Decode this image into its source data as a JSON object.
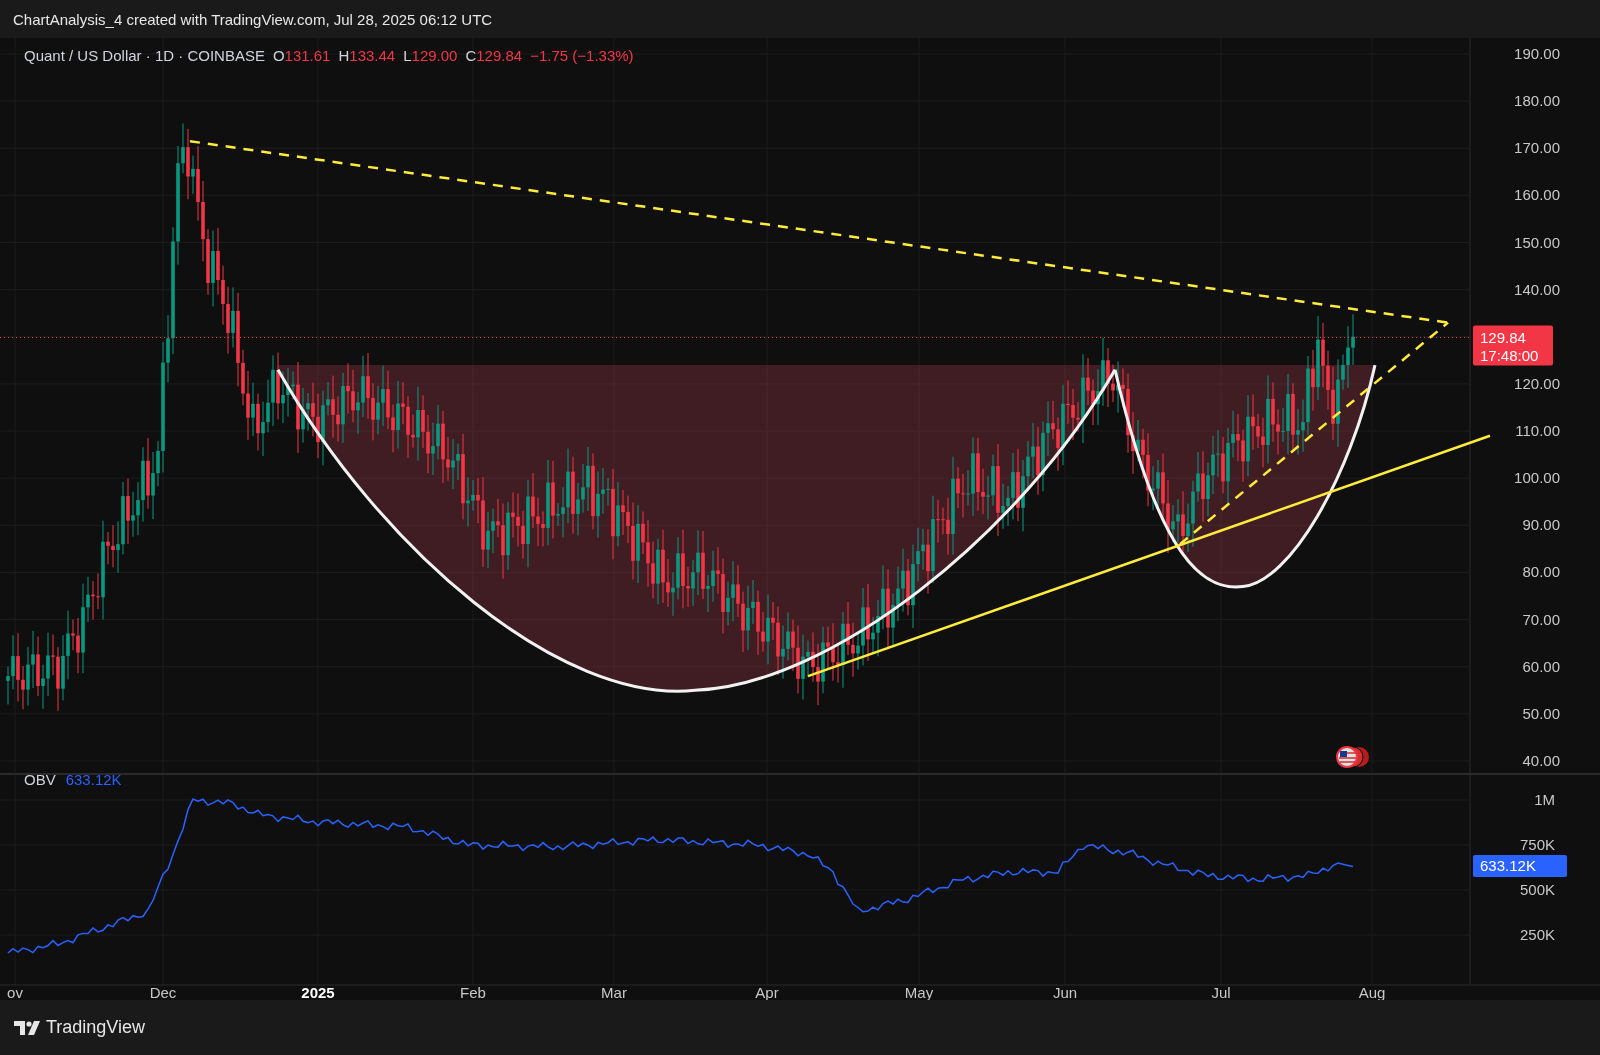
{
  "header": {
    "title": "ChartAnalysis_4 created with TradingView.com, Jul 28, 2025 06:12 UTC"
  },
  "legend": {
    "symbol": "Quant / US Dollar · 1D · COINBASE",
    "down": true,
    "fields": [
      {
        "label": "O",
        "value": "131.61"
      },
      {
        "label": "H",
        "value": "133.44"
      },
      {
        "label": "L",
        "value": "129.00"
      },
      {
        "label": "C",
        "value": "129.84"
      }
    ],
    "change": "−1.75 (−1.33%)"
  },
  "price_axis": {
    "ticks": [
      "190.00",
      "180.00",
      "170.00",
      "160.00",
      "150.00",
      "140.00",
      "120.00",
      "110.00",
      "100.00",
      "90.00",
      "80.00",
      "70.00",
      "60.00",
      "50.00",
      "40.00"
    ]
  },
  "last_price": {
    "value": "129.84",
    "countdown": "17:48:00"
  },
  "obv": {
    "label": "OBV",
    "value": "633.12K",
    "ticks": [
      "1M",
      "750K",
      "500K",
      "250K"
    ],
    "last_value": "633.12K"
  },
  "time_axis": {
    "ticks": [
      {
        "label": "ov",
        "kind": "month"
      },
      {
        "label": "Dec",
        "kind": "month"
      },
      {
        "label": "2025",
        "kind": "year"
      },
      {
        "label": "Feb",
        "kind": "month"
      },
      {
        "label": "Mar",
        "kind": "month"
      },
      {
        "label": "Apr",
        "kind": "month"
      },
      {
        "label": "May",
        "kind": "month"
      },
      {
        "label": "Jun",
        "kind": "month"
      },
      {
        "label": "Jul",
        "kind": "month"
      },
      {
        "label": "Aug",
        "kind": "month"
      }
    ]
  },
  "footer": {
    "brand": "TradingView"
  }
}
